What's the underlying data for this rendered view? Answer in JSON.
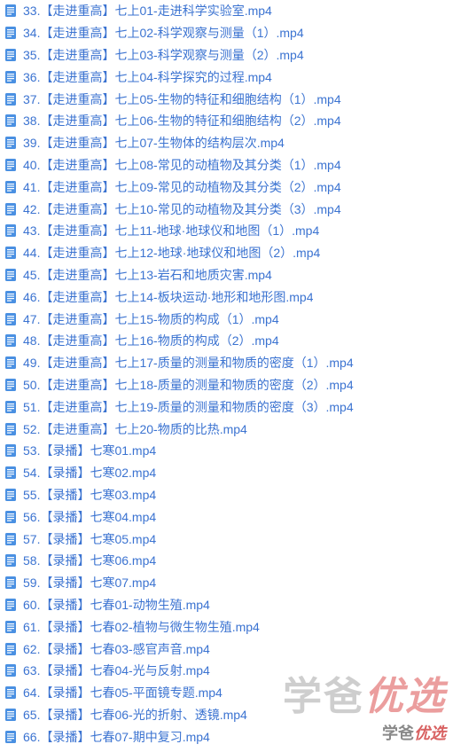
{
  "files": [
    {
      "n": "33.【走进重高】七上01-走进科学实验室.mp4"
    },
    {
      "n": "34.【走进重高】七上02-科学观察与测量（1）.mp4"
    },
    {
      "n": "35.【走进重高】七上03-科学观察与测量（2）.mp4"
    },
    {
      "n": "36.【走进重高】七上04-科学探究的过程.mp4"
    },
    {
      "n": "37.【走进重高】七上05-生物的特征和细胞结构（1）.mp4"
    },
    {
      "n": "38.【走进重高】七上06-生物的特征和细胞结构（2）.mp4"
    },
    {
      "n": "39.【走进重高】七上07-生物体的结构层次.mp4"
    },
    {
      "n": "40.【走进重高】七上08-常见的动植物及其分类（1）.mp4"
    },
    {
      "n": "41.【走进重高】七上09-常见的动植物及其分类（2）.mp4"
    },
    {
      "n": "42.【走进重高】七上10-常见的动植物及其分类（3）.mp4"
    },
    {
      "n": "43.【走进重高】七上11-地球·地球仪和地图（1）.mp4"
    },
    {
      "n": "44.【走进重高】七上12-地球·地球仪和地图（2）.mp4"
    },
    {
      "n": "45.【走进重高】七上13-岩石和地质灾害.mp4"
    },
    {
      "n": "46.【走进重高】七上14-板块运动·地形和地形图.mp4"
    },
    {
      "n": "47.【走进重高】七上15-物质的构成（1）.mp4"
    },
    {
      "n": "48.【走进重高】七上16-物质的构成（2）.mp4"
    },
    {
      "n": "49.【走进重高】七上17-质量的测量和物质的密度（1）.mp4"
    },
    {
      "n": "50.【走进重高】七上18-质量的测量和物质的密度（2）.mp4"
    },
    {
      "n": "51.【走进重高】七上19-质量的测量和物质的密度（3）.mp4"
    },
    {
      "n": "52.【走进重高】七上20-物质的比热.mp4"
    },
    {
      "n": "53.【录播】七寒01.mp4"
    },
    {
      "n": "54.【录播】七寒02.mp4"
    },
    {
      "n": "55.【录播】七寒03.mp4"
    },
    {
      "n": "56.【录播】七寒04.mp4"
    },
    {
      "n": "57.【录播】七寒05.mp4"
    },
    {
      "n": "58.【录播】七寒06.mp4"
    },
    {
      "n": "59.【录播】七寒07.mp4"
    },
    {
      "n": "60.【录播】七春01-动物生殖.mp4"
    },
    {
      "n": "61.【录播】七春02-植物与微生物生殖.mp4"
    },
    {
      "n": "62.【录播】七春03-感官声音.mp4"
    },
    {
      "n": "63.【录播】七春04-光与反射.mp4"
    },
    {
      "n": "64.【录播】七春05-平面镜专题.mp4"
    },
    {
      "n": "65.【录播】七春06-光的折射、透镜.mp4"
    },
    {
      "n": "66.【录播】七春07-期中复习.mp4"
    }
  ],
  "watermark": {
    "part1": "学爸",
    "part2": "优选"
  }
}
